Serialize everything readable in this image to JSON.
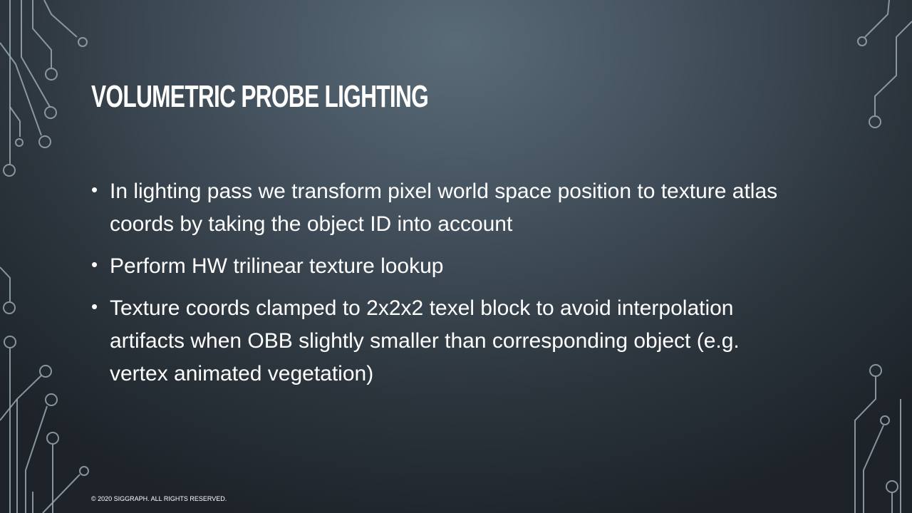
{
  "slide": {
    "title": "Volumetric Probe Lighting",
    "bullets": [
      {
        "text": "In lighting pass we transform pixel world space position to texture atlas coords by taking the object ID into account"
      },
      {
        "text": "Perform HW trilinear texture lookup"
      },
      {
        "text": "Texture coords clamped to 2x2x2 texel block to avoid interpolation artifacts when OBB slightly smaller than corresponding object (e.g. vertex animated vegetation)"
      }
    ],
    "bullet_glyph": "•",
    "footer": "© 2020 SIGGRAPH. ALL RIGHTS RESERVED."
  },
  "decor": {
    "left_icon": "circuit-lines-decoration",
    "right_icon": "circuit-lines-decoration",
    "line_color": "#9aa8b3"
  }
}
